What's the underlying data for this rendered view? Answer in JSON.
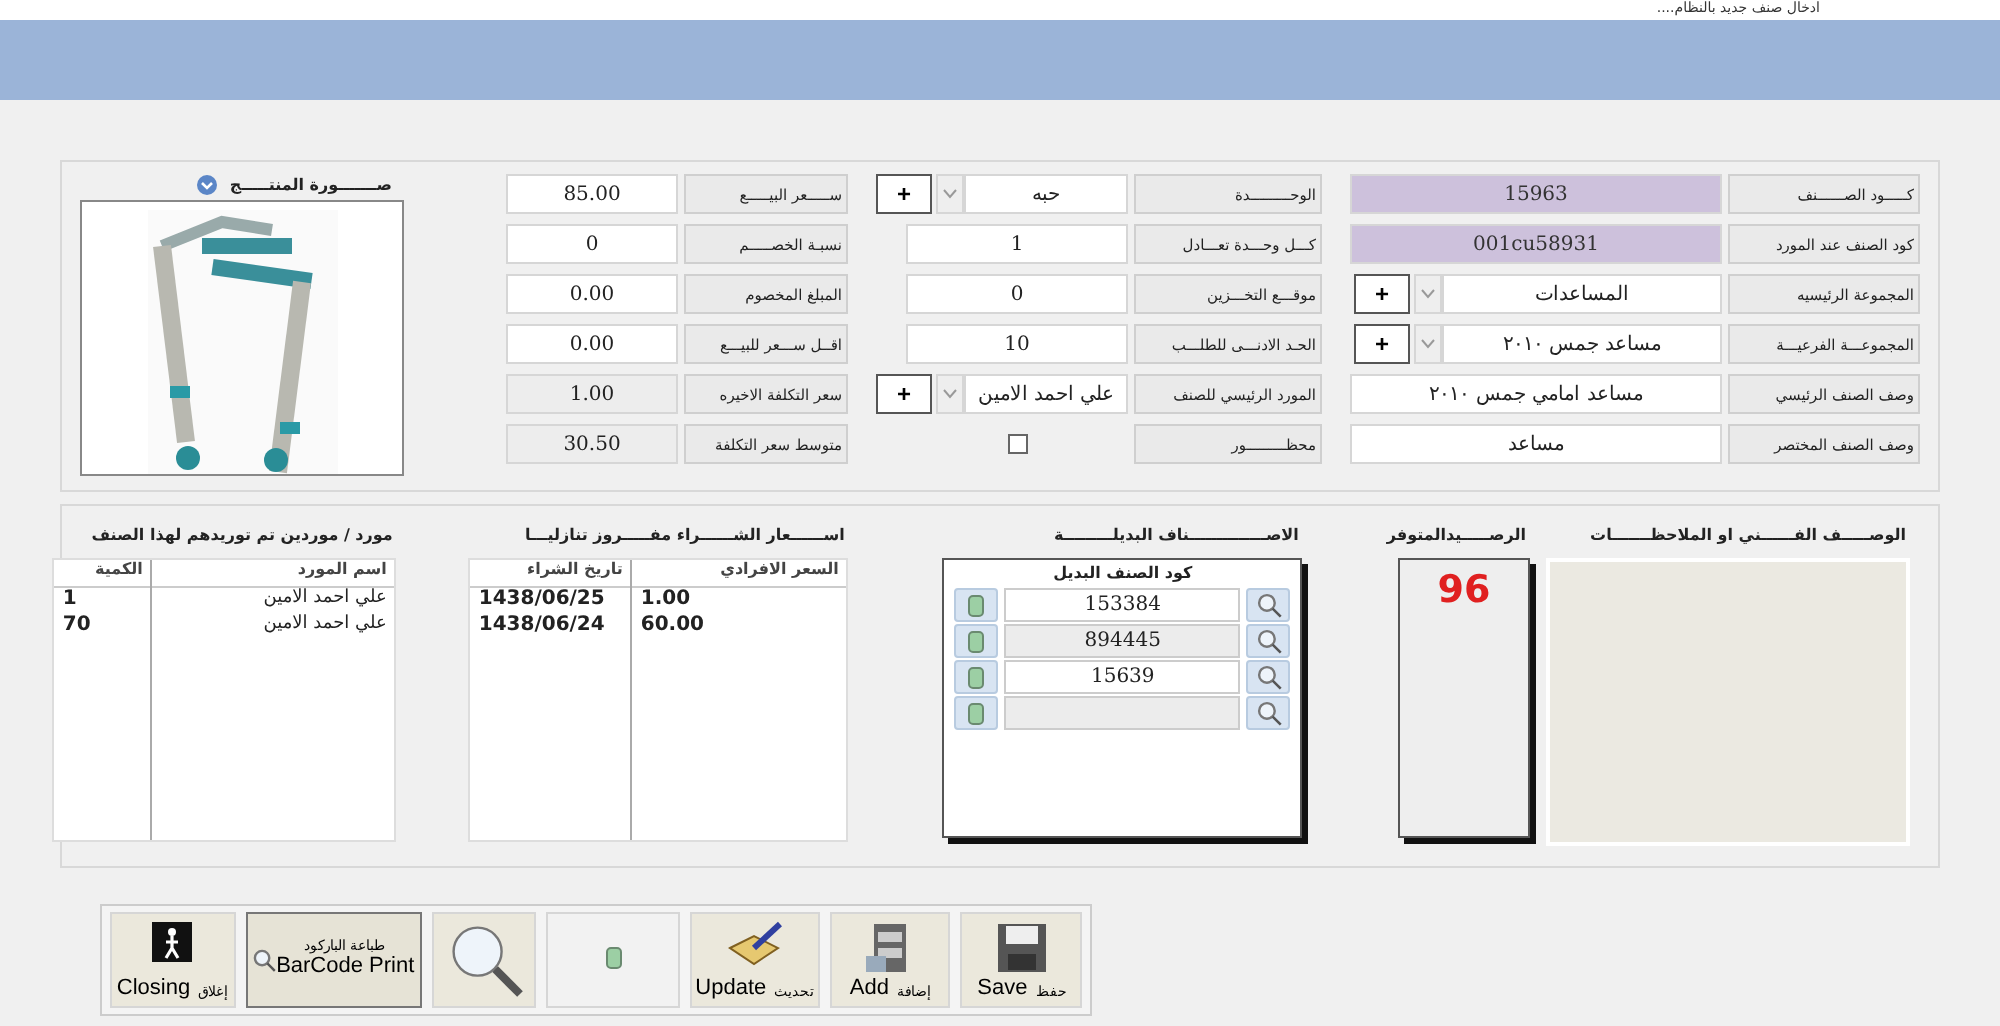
{
  "window": {
    "title": "....ادخال صنف جديد بالنظام"
  },
  "item_fields": [
    {
      "kind": "code",
      "label": "كـــــود الصــــــنف",
      "value": "15963"
    },
    {
      "kind": "code",
      "label": "كود الصنف عند المورد",
      "value": "001cu58931"
    },
    {
      "kind": "combo",
      "label": "المجموعة الرئيسيه",
      "value": "المساعدات",
      "add_button": "+"
    },
    {
      "kind": "combo",
      "label": "المجموعـــة الفرعيـــة",
      "value": "مساعد جمس ٢٠١٠",
      "add_button": "+"
    },
    {
      "kind": "text",
      "label": "وصف الصنف الرئيسي",
      "value": "مساعد امامي جمس ٢٠١٠"
    },
    {
      "kind": "text",
      "label": "وصف الصنف المختصر",
      "value": "مساعد"
    }
  ],
  "stock_fields": [
    {
      "kind": "combo",
      "label": "الوحـــــــــدة",
      "value": "حبه",
      "add_button": "+"
    },
    {
      "kind": "text",
      "label": "كـــل وحـــدة تعـــادل",
      "value": "1"
    },
    {
      "kind": "text",
      "label": "موقـــع التخـــزين",
      "value": "0"
    },
    {
      "kind": "text",
      "label": "الحـد الادنـــى للطلـــب",
      "value": "10"
    },
    {
      "kind": "combo",
      "label": "المورد الرئيسي للصنف",
      "value": "علي احمد الامين",
      "add_button": "+"
    },
    {
      "kind": "checkbox",
      "label": "محظـــــــــور",
      "checked": false
    }
  ],
  "price_fields": [
    {
      "kind": "input",
      "label": "ســـــعر البيـــــع",
      "value": "85.00"
    },
    {
      "kind": "input",
      "label": "نسبـة الخصـــــم",
      "value": "0"
    },
    {
      "kind": "input",
      "label": "المبلغ المخصوم",
      "value": "0.00"
    },
    {
      "kind": "input",
      "label": "اقــل ســـعر للبيـــع",
      "value": "0.00"
    },
    {
      "kind": "readonly",
      "label": "سعر التكلفة الاخيره",
      "value": "1.00"
    },
    {
      "kind": "readonly",
      "label": "متوسط سعر التكلفة",
      "value": "30.50"
    }
  ],
  "product_image": {
    "title": "صـــــــورة المنتـــــج",
    "kind": "picture"
  },
  "notes": {
    "title": "الوصـــــف الفــــــني او الملاحظـــــــات"
  },
  "balance": {
    "title": "الرصـــــيدالمتوفر",
    "value": "96"
  },
  "alternates": {
    "title": "الاصــــــــــــــناف البديلـــــــــة",
    "column": "كود الصنف البديل",
    "rows": [
      {
        "kind": "filled",
        "code": "153384"
      },
      {
        "kind": "filled",
        "code": "894445"
      },
      {
        "kind": "filled",
        "code": "15639"
      },
      {
        "kind": "empty"
      }
    ]
  },
  "purchase_prices": {
    "title": "اســــــعار الشــــــراء مفـــــروز تنازليـــا",
    "columns": [
      "السعر الافرادي",
      "تاريخ الشراء"
    ],
    "rows": [
      [
        "1.00",
        "1438/06/25"
      ],
      [
        "60.00",
        "1438/06/24"
      ]
    ]
  },
  "suppliers": {
    "title": "مورد / موردين تم توريدهم لهذا الصنف",
    "columns": [
      "اسم المورد",
      "الكمية"
    ],
    "rows": [
      [
        "علي احمد الامين",
        "1"
      ],
      [
        "علي احمد الامين",
        "70"
      ]
    ]
  },
  "buttons": [
    {
      "kind": "save",
      "label": "Save",
      "label_ar": "حفظ"
    },
    {
      "kind": "add",
      "label": "Add",
      "label_ar": "إضافة"
    },
    {
      "kind": "update",
      "label": "Update",
      "label_ar": "تحديث"
    },
    {
      "kind": "delete"
    },
    {
      "kind": "search"
    },
    {
      "kind": "barcode",
      "label": "BarCode Print",
      "label_ar": "طباعة الباركود"
    },
    {
      "kind": "close",
      "label": "Closing",
      "label_ar": "إغلاق"
    }
  ]
}
